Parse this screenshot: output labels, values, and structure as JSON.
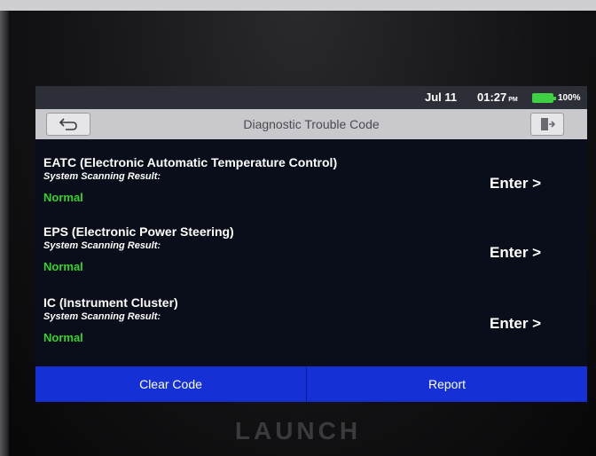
{
  "status_bar": {
    "date": "Jul 11",
    "time": "01:27",
    "ampm": "PM",
    "battery": "100%"
  },
  "header": {
    "title": "Diagnostic Trouble Code",
    "back_icon": "back-arrow-icon",
    "exit_icon": "exit-icon"
  },
  "systems": [
    {
      "name": "EATC (Electronic Automatic Temperature Control)",
      "scan_label": "System Scanning Result:",
      "result": "Normal",
      "action": "Enter >"
    },
    {
      "name": "EPS (Electronic Power Steering)",
      "scan_label": "System Scanning Result:",
      "result": "Normal",
      "action": "Enter >"
    },
    {
      "name": "IC (Instrument Cluster)",
      "scan_label": "System Scanning Result:",
      "result": "Normal",
      "action": "Enter >"
    }
  ],
  "footer": {
    "clear_label": "Clear Code",
    "report_label": "Report"
  },
  "device": {
    "brand": "LAUNCH"
  },
  "colors": {
    "accent_blue": "#1531d6",
    "status_ok": "#39d12f",
    "battery_green": "#3fd143"
  }
}
